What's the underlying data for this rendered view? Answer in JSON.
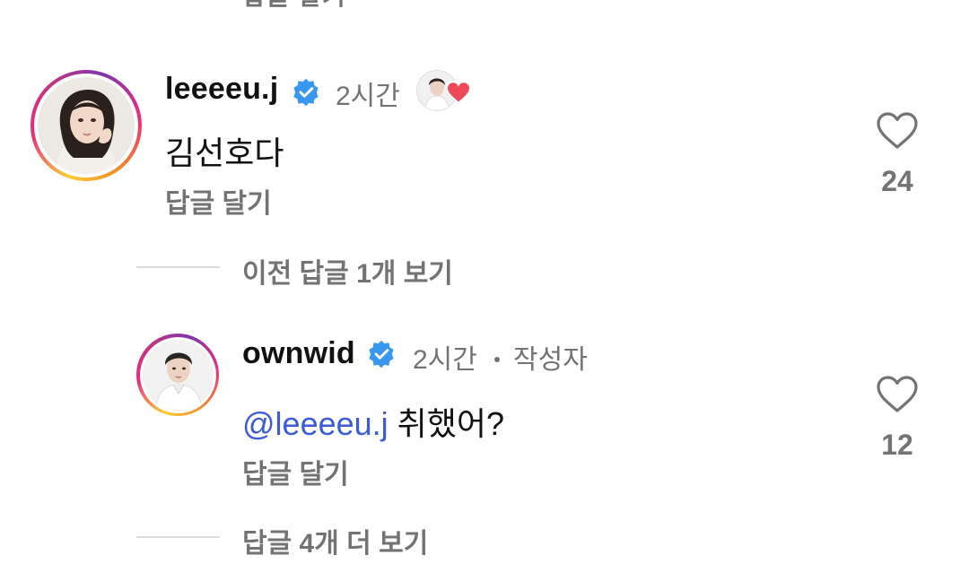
{
  "top_cutoff_text": "답글 달기",
  "comments": [
    {
      "username": "leeeeu.j",
      "time": "2시간",
      "text": "김선호다",
      "reply_label": "답글 달기",
      "likes": "24"
    },
    {
      "username": "ownwid",
      "time": "2시간",
      "author_label": "작성자",
      "mention": "@leeeeu.j",
      "text": " 취했어?",
      "reply_label": "답글 달기",
      "likes": "12"
    }
  ],
  "threads": {
    "previous_replies": "이전 답글 1개 보기",
    "more_replies": "답글 4개 더 보기"
  },
  "colors": {
    "verified_badge": "#3897f0",
    "liked_heart": "#ed4956",
    "mention": "#3b5bdb",
    "secondary_text": "#737373"
  }
}
